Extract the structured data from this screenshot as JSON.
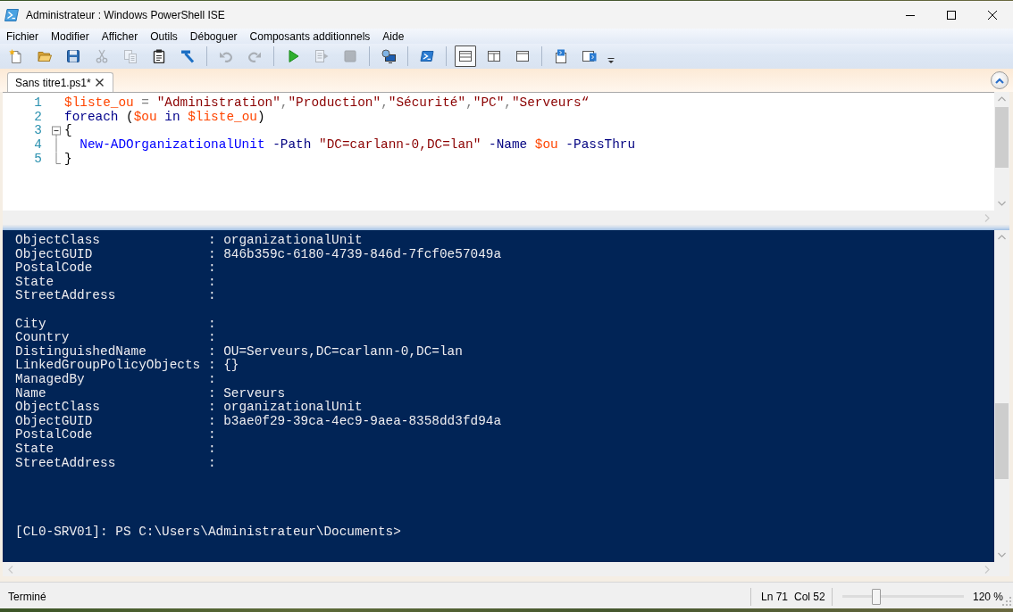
{
  "window": {
    "title": "Administrateur : Windows PowerShell ISE"
  },
  "menu": [
    "Fichier",
    "Modifier",
    "Afficher",
    "Outils",
    "Déboguer",
    "Composants additionnels",
    "Aide"
  ],
  "toolbar": {
    "groups": [
      [
        {
          "disabled": false
        },
        {
          "disabled": false
        },
        {
          "disabled": false
        },
        {
          "disabled": true
        },
        {
          "disabled": true
        },
        {
          "disabled": false
        },
        {
          "disabled": false
        }
      ],
      [
        {
          "disabled": true
        },
        {
          "disabled": true
        }
      ],
      [
        {
          "disabled": false
        },
        {
          "disabled": true
        },
        {
          "disabled": true
        }
      ],
      [
        {
          "disabled": false
        }
      ],
      [
        {
          "disabled": false
        }
      ],
      [
        {
          "disabled": false,
          "selected": true
        },
        {
          "disabled": false,
          "selected": false
        },
        {
          "disabled": false,
          "selected": false
        }
      ],
      [
        {
          "disabled": false
        },
        {
          "disabled": false
        }
      ]
    ]
  },
  "tabs": [
    {
      "label": "Sans titre1.ps1*",
      "selected": true
    }
  ],
  "editor": {
    "lines": [
      {
        "number": "1",
        "kind": "plain",
        "tokens": [
          {
            "kind": "variable",
            "text": "$liste_ou"
          },
          {
            "kind": "operator",
            "text": " = "
          },
          {
            "kind": "string",
            "text": "\"Administration\""
          },
          {
            "kind": "operator",
            "text": ","
          },
          {
            "kind": "string",
            "text": "\"Production\""
          },
          {
            "kind": "operator",
            "text": ","
          },
          {
            "kind": "string",
            "text": "\"Sécurité\""
          },
          {
            "kind": "operator",
            "text": ","
          },
          {
            "kind": "string",
            "text": "\"PC\""
          },
          {
            "kind": "operator",
            "text": ","
          },
          {
            "kind": "string",
            "text": "\"Serveurs“"
          }
        ]
      },
      {
        "number": "2",
        "kind": "plain",
        "tokens": [
          {
            "kind": "keyword",
            "text": "foreach"
          },
          {
            "kind": "group",
            "text": " ("
          },
          {
            "kind": "variable",
            "text": "$ou"
          },
          {
            "kind": "keyword",
            "text": " in "
          },
          {
            "kind": "variable",
            "text": "$liste_ou"
          },
          {
            "kind": "group",
            "text": ")"
          }
        ]
      },
      {
        "number": "3",
        "kind": "open",
        "tokens": [
          {
            "kind": "group",
            "text": "{"
          }
        ]
      },
      {
        "number": "4",
        "kind": "body",
        "tokens": [
          {
            "kind": "command",
            "text": "  New-ADOrganizationalUnit"
          },
          {
            "kind": "parameter",
            "text": " -Path"
          },
          {
            "kind": "string",
            "text": " \"DC=carlann-0,DC=lan\""
          },
          {
            "kind": "parameter",
            "text": " -Name"
          },
          {
            "kind": "variable",
            "text": " $ou"
          },
          {
            "kind": "parameter",
            "text": " -PassThru"
          }
        ]
      },
      {
        "number": "5",
        "kind": "close",
        "tokens": [
          {
            "kind": "group",
            "text": "}"
          }
        ]
      }
    ]
  },
  "console": {
    "records": [
      {
        "lines": [
          "ObjectClass              : organizationalUnit",
          "ObjectGUID               : 846b359c-6180-4739-846d-7fcf0e57049a",
          "PostalCode               :",
          "State                    :",
          "StreetAddress            :"
        ]
      },
      {
        "lines": [
          "City                     :",
          "Country                  :",
          "DistinguishedName        : OU=Serveurs,DC=carlann-0,DC=lan",
          "LinkedGroupPolicyObjects : {}",
          "ManagedBy                :",
          "Name                     : Serveurs",
          "ObjectClass              : organizationalUnit",
          "ObjectGUID               : b3ae0f29-39ca-4ec9-9aea-8358dd3fd94a",
          "PostalCode               :",
          "State                    :",
          "StreetAddress            :"
        ]
      }
    ],
    "prompt": "[CL0-SRV01]: PS C:\\Users\\Administrateur\\Documents>"
  },
  "status_bar": {
    "message": "Terminé",
    "line": "Ln 71",
    "column": "Col 52",
    "zoom": {
      "level": 0.26,
      "reading": "120 %"
    }
  }
}
